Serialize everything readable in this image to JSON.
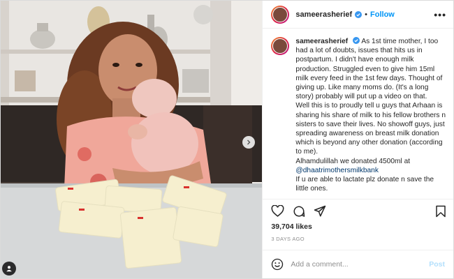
{
  "post": {
    "username": "sameerasherief",
    "follow_label": "Follow",
    "more_label": "•••",
    "caption": {
      "username": "sameerasherief",
      "body": "As 1st time mother, I too had a lot of doubts, issues that hits us in postpartum. I didn't have enough milk production. Struggled even to give him 15ml milk every feed in the 1st few days. Thought of giving up. Like many moms do. (It's a long story) probably will put up a video on that.\nWell this is to proudly tell u guys that Arhaan is sharing his share of milk to his fellow brothers n sisters to save their lives. No showoff guys, just spreading awareness on breast milk donation which is beyond any other donation (according to me).\nAlhamdulillah we donated 4500ml at ",
      "mention": "@dhaatrimothersmilkbank",
      "tail": "\nIf u are able to lactate plz donate n save the little ones."
    },
    "likes": "39,704 likes",
    "date": "3 DAYS AGO",
    "comment_placeholder": "Add a comment...",
    "post_label": "Post"
  },
  "colors": {
    "accent": "#0095f6",
    "post_disabled": "#b2dffc",
    "mention": "#00376b"
  },
  "icons": {
    "like": "heart-icon",
    "comment": "comment-icon",
    "share": "share-icon",
    "save": "bookmark-icon",
    "emoji": "emoji-icon",
    "next": "chevron-right-icon",
    "tags": "user-tag-icon"
  }
}
